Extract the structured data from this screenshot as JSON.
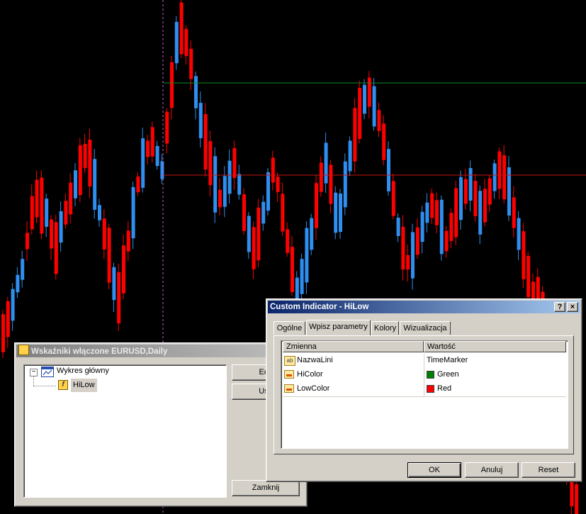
{
  "chart": {
    "colors": {
      "bull": "#2f8ff0",
      "bear": "#ff0000",
      "green_line": "#0b8c24",
      "red_line": "#c81414",
      "vline": "#c060c0",
      "wick_bull": "#2f8ff0",
      "wick_bear": "#ff0000"
    }
  },
  "indicators_window": {
    "title": "Wskaźniki włączone EURUSD,Daily",
    "tree": {
      "root_label": "Wykres główny",
      "child_label": "HiLow"
    },
    "buttons": {
      "edit": "Edy",
      "delete": "Usu",
      "close": "Zamknij"
    }
  },
  "custom_indicator": {
    "title": "Custom Indicator - HiLow",
    "title_buttons": {
      "help": "?",
      "close": "×"
    },
    "tabs": [
      "Ogólne",
      "Wpisz parametry",
      "Kolory",
      "Wizualizacja"
    ],
    "active_tab": 1,
    "table": {
      "headers": [
        "Zmienna",
        "Wartość"
      ],
      "rows": [
        {
          "name": "NazwaLini",
          "value": "TimeMarker",
          "icon": "text-param-icon",
          "swatch": null
        },
        {
          "name": "HiColor",
          "value": "Green",
          "icon": "color-param-icon",
          "swatch": "#008000"
        },
        {
          "name": "LowColor",
          "value": "Red",
          "icon": "color-param-icon",
          "swatch": "#ff0000"
        }
      ]
    },
    "buttons": {
      "ok": "OK",
      "cancel": "Anuluj",
      "reset": "Reset"
    }
  }
}
